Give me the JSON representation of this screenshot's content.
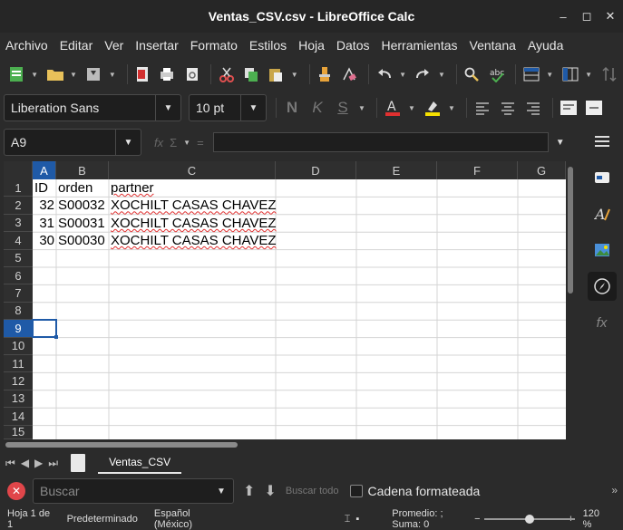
{
  "window": {
    "title": "Ventas_CSV.csv - LibreOffice Calc",
    "controls": {
      "minimize": "–",
      "maximize": "◻",
      "close": "✕"
    }
  },
  "menu": [
    "Archivo",
    "Editar",
    "Ver",
    "Insertar",
    "Formato",
    "Estilos",
    "Hoja",
    "Datos",
    "Herramientas",
    "Ventana",
    "Ayuda"
  ],
  "toolbar": {
    "icons": [
      "new-icon",
      "open-icon",
      "save-icon",
      "export-pdf-icon",
      "print-icon",
      "print-preview-icon",
      "cut-icon",
      "copy-icon",
      "paste-icon",
      "clone-format-icon",
      "clear-format-icon",
      "undo-icon",
      "redo-icon",
      "spellcheck-icon",
      "autospell-icon",
      "row-icon",
      "column-icon",
      "sort-icon"
    ]
  },
  "formatting": {
    "font_name": "Liberation Sans",
    "font_size": "10 pt",
    "bold": "N",
    "italic": "K",
    "underline": "S",
    "font_color": "#e03030",
    "highlight_color": "#f5e000"
  },
  "formula": {
    "name_box": "A9",
    "fx": "fx",
    "sigma": "Σ",
    "equals": "=",
    "content": ""
  },
  "sheet": {
    "columns": [
      "A",
      "B",
      "C",
      "D",
      "E",
      "F",
      "G"
    ],
    "rows": [
      "1",
      "2",
      "3",
      "4",
      "5",
      "6",
      "7",
      "8",
      "9",
      "10",
      "11",
      "12",
      "13",
      "14",
      "15"
    ],
    "selected_column": "A",
    "selected_row": "9",
    "cells": {
      "r1": [
        "ID",
        "orden",
        "partner"
      ],
      "r2": [
        "32",
        "S00032",
        "XOCHILT CASAS CHAVEZ"
      ],
      "r3": [
        "31",
        "S00031",
        "XOCHILT CASAS CHAVEZ"
      ],
      "r4": [
        "30",
        "S00030",
        "XOCHILT CASAS CHAVEZ"
      ]
    }
  },
  "tabs": {
    "nav": [
      "⏮",
      "◀",
      "▶",
      "⏭"
    ],
    "sheet_name": "Ventas_CSV"
  },
  "find": {
    "placeholder": "Buscar",
    "find_all": "Buscar todo",
    "formatted_label": "Cadena formateada",
    "more": "»"
  },
  "status": {
    "sheet": "Hoja 1 de 1",
    "style": "Predeterminado",
    "language": "Español (México)",
    "summary": "Promedio: ; Suma: 0",
    "zoom": "120 %",
    "zoom_minus": "−",
    "zoom_plus": "+",
    "zoom_fraction": 0.5
  },
  "sidebar": [
    "hamburger-icon",
    "properties-icon",
    "styles-icon",
    "gallery-icon",
    "navigator-icon",
    "functions-icon"
  ]
}
